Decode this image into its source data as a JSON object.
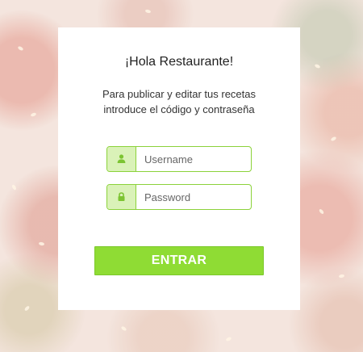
{
  "card": {
    "title": "¡Hola Restaurante!",
    "subtitle_line1": "Para publicar y editar tus recetas",
    "subtitle_line2": "introduce el código y contraseña"
  },
  "form": {
    "username": {
      "placeholder": "Username",
      "value": "",
      "icon": "user-icon"
    },
    "password": {
      "placeholder": "Password",
      "value": "",
      "icon": "lock-icon"
    },
    "submit_label": "ENTRAR"
  },
  "colors": {
    "accent": "#8fdc34",
    "accent_border": "#8bd23a",
    "icon_bg": "#daf2b8"
  }
}
